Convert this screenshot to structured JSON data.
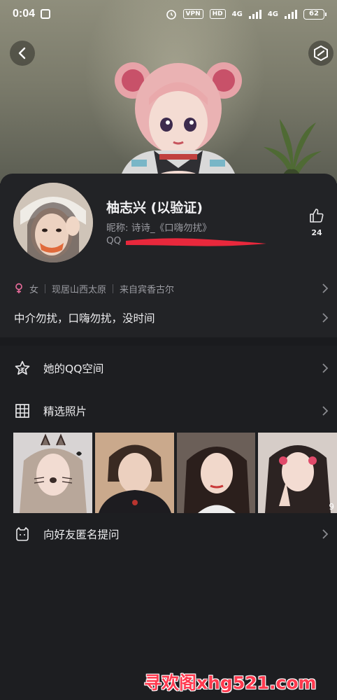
{
  "status_bar": {
    "time": "0:04",
    "vpn_label": "VPN",
    "hd_label": "HD",
    "network1": "4G",
    "network2": "4G",
    "battery": "62"
  },
  "profile": {
    "name": "柚志兴 (以验证)",
    "nickname": "昵称: 诗诗_《口嗨勿扰》",
    "qq_prefix": "QQ",
    "likes": "24",
    "gender_label": "女",
    "location": "现居山西太原",
    "hometown": "来自宾香古尔",
    "signature": "中介勿扰，口嗨勿扰，没时间"
  },
  "menu": {
    "zone_label": "她的QQ空间",
    "photos_label": "精选照片",
    "ask_label": "向好友匿名提问"
  },
  "photos": {
    "more_count": "9"
  },
  "watermark": "寻欢阁xhg521.com",
  "colors": {
    "background": "#1d1e21",
    "card": "#222326",
    "text_primary": "#ededef",
    "text_secondary": "#9a9ba1",
    "gender_female": "#e76b9a",
    "redaction": "#e8283c"
  },
  "icons": {
    "back": "back-arrow-icon",
    "skin": "hexagon-icon",
    "like": "thumbs-up-icon",
    "gender": "female-icon",
    "zone": "star-icon",
    "photos": "grid-icon",
    "ask": "mask-icon",
    "chevron": "chevron-right-icon"
  }
}
